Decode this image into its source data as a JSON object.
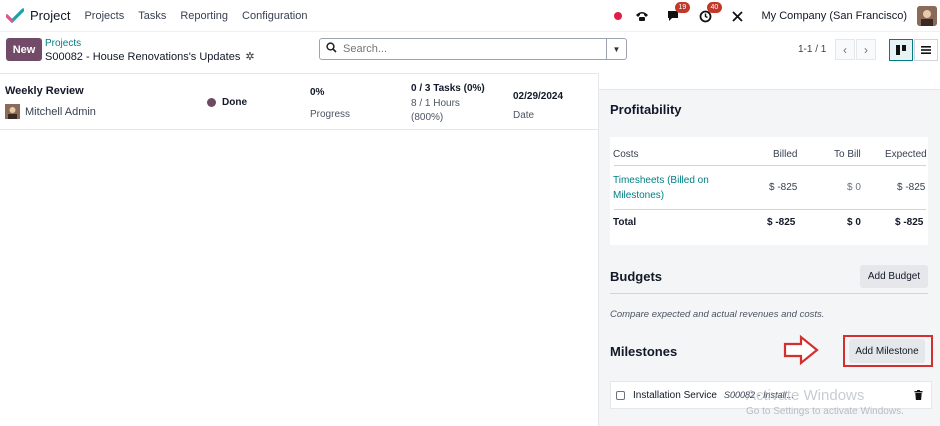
{
  "navbar": {
    "app_title": "Project",
    "menu": [
      "Projects",
      "Tasks",
      "Reporting",
      "Configuration"
    ],
    "messages_badge": "19",
    "activities_badge": "40",
    "company": "My Company (San Francisco)"
  },
  "control": {
    "new_label": "New",
    "breadcrumb_parent": "Projects",
    "breadcrumb_current": "S00082 - House Renovations's Updates",
    "search_placeholder": "Search...",
    "pager": "1-1 / 1"
  },
  "update_card": {
    "title": "Weekly Review",
    "user": "Mitchell Admin",
    "status": "Done",
    "progress_value": "0%",
    "progress_label": "Progress",
    "tasks": "0 / 3 Tasks (0%)",
    "hours": "8 / 1 Hours",
    "hours_pct": "(800%)",
    "date_value": "02/29/2024",
    "date_label": "Date"
  },
  "profitability": {
    "heading": "Profitability",
    "columns": [
      "Costs",
      "Billed",
      "To Bill",
      "Expected"
    ],
    "rows": [
      {
        "label_line1": "Timesheets (Billed on",
        "label_line2": "Milestones)",
        "billed": "$ -825",
        "to_bill": "$ 0",
        "expected": "$ -825"
      }
    ],
    "total": {
      "label": "Total",
      "billed": "$ -825",
      "to_bill": "$ 0",
      "expected": "$ -825"
    }
  },
  "budgets": {
    "heading": "Budgets",
    "add_label": "Add Budget",
    "hint": "Compare expected and actual revenues and costs."
  },
  "milestones": {
    "heading": "Milestones",
    "add_label": "Add Milestone",
    "items": [
      {
        "name": "Installation Service",
        "ref": "S00082 - Install..."
      }
    ]
  },
  "watermark": {
    "line1": "Activate Windows",
    "line2": "Go to Settings to activate Windows."
  },
  "colors": {
    "brand": "#714b67",
    "link": "#017e84",
    "highlight": "#d32f2f"
  }
}
